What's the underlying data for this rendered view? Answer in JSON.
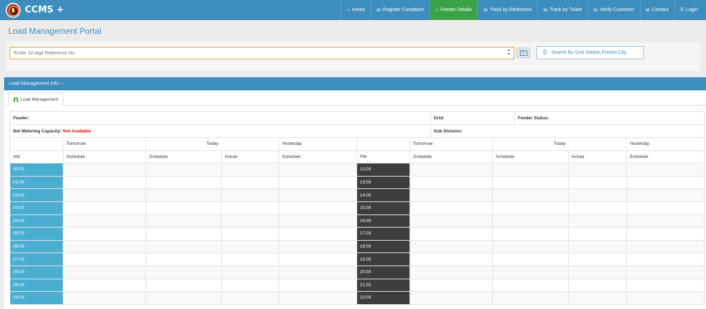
{
  "app": {
    "brand": "CCMS +"
  },
  "nav": [
    {
      "label": "Home",
      "icon": "home-icon",
      "glyph": "⌂",
      "active": false
    },
    {
      "label": "Register Complaint",
      "icon": "comments-icon",
      "glyph": "✉",
      "active": false
    },
    {
      "label": "Feeder Details",
      "icon": "home-icon",
      "glyph": "⌂",
      "active": true
    },
    {
      "label": "Track by Reference",
      "icon": "comments-icon",
      "glyph": "✉",
      "active": false
    },
    {
      "label": "Track by Ticket",
      "icon": "comments-icon",
      "glyph": "✉",
      "active": false
    },
    {
      "label": "Verify Customer",
      "icon": "comments-icon",
      "glyph": "✉",
      "active": false
    },
    {
      "label": "Contact",
      "icon": "envelope-icon",
      "glyph": "✉",
      "active": false
    },
    {
      "label": "Login",
      "icon": "key-icon",
      "glyph": "⚿",
      "active": false
    }
  ],
  "page": {
    "title": "Load Management Portal"
  },
  "search": {
    "placeholder": "*Enter 14 digit Reference No.",
    "grid_search_label": "Search By Grid Station,Feeder,City"
  },
  "info_bar": {
    "title": "Load Management Info --"
  },
  "tab": {
    "label": "Load Management"
  },
  "info": {
    "feeder_label": "Feeder:",
    "grid_label": "Grid:",
    "feeder_status_label": "Feeder Status:",
    "net_metering_label": "Net Metering Capacity:",
    "net_metering_value": "Not Available",
    "sub_division_label": "Sub Division:"
  },
  "schedule": {
    "headers": {
      "tomorrow": "Tomorrow",
      "today": "Today",
      "yesterday": "Yesterday",
      "am": "AM",
      "pm": "PM",
      "schedule": "Schedule",
      "actual": "Actual"
    },
    "am_times": [
      "00:00",
      "01:00",
      "02:00",
      "03:00",
      "04:00",
      "05:00",
      "06:00",
      "07:00",
      "08:00",
      "09:00",
      "10:00"
    ],
    "pm_times": [
      "12:00",
      "13:00",
      "14:00",
      "15:00",
      "16:00",
      "17:00",
      "18:00",
      "19:00",
      "20:00",
      "21:00",
      "22:00"
    ]
  }
}
